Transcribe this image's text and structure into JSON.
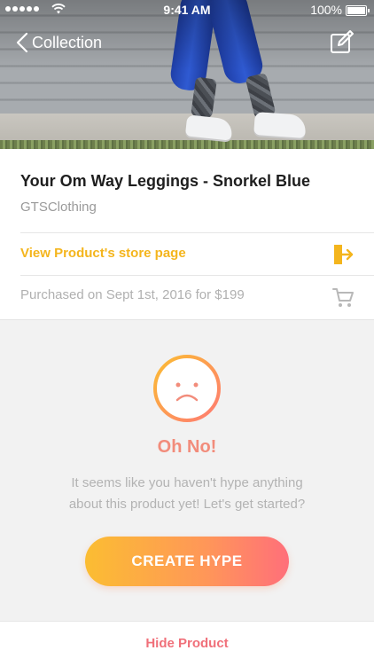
{
  "status_bar": {
    "time": "9:41 AM",
    "battery": "100%",
    "signal_icon": "signal-dots-icon",
    "wifi_icon": "wifi-icon",
    "battery_icon": "battery-icon"
  },
  "nav": {
    "back_label": "Collection",
    "back_icon": "chevron-left-icon",
    "edit_icon": "edit-icon"
  },
  "hero": {
    "description_icon": "product-photo"
  },
  "product": {
    "title": "Your Om Way Leggings - Snorkel Blue",
    "brand": "GTSClothing",
    "store_link": "View Product's store page",
    "store_icon": "exit-icon",
    "purchase_info": "Purchased on Sept 1st, 2016 for $199",
    "purchase_icon": "cart-icon"
  },
  "empty_state": {
    "icon": "sad-face-icon",
    "heading": "Oh No!",
    "message_line1": "It seems like you haven't hype anything",
    "message_line2": "about this product yet! Let's get started?",
    "button_label": "CREATE HYPE"
  },
  "footer": {
    "hide_label": "Hide Product"
  },
  "colors": {
    "accent_yellow": "#f4b51d",
    "coral": "#f28c7b",
    "pink": "#f0707a",
    "gradient_start": "#fbbd32",
    "gradient_end": "#ff6f7a"
  }
}
